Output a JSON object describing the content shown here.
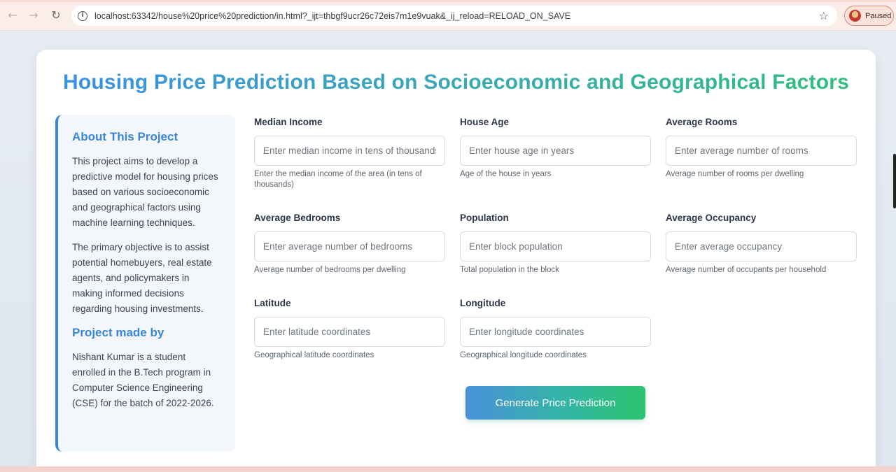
{
  "browser": {
    "url": "localhost:63342/house%20price%20prediction/in.html?_ijt=thbgf9ucr26c72eis7m1e9vuak&_ij_reload=RELOAD_ON_SAVE",
    "back_icon": "←",
    "forward_icon": "→",
    "reload_icon": "↻",
    "info_icon": "i",
    "star_icon": "☆",
    "profile_status": "Paused"
  },
  "page": {
    "title": "Housing Price Prediction Based on Socioeconomic and Geographical Factors"
  },
  "sidebar": {
    "about_heading": "About This Project",
    "about_p1": "This project aims to develop a predictive model for housing prices based on various socioeconomic and geographical factors using machine learning techniques.",
    "about_p2": "The primary objective is to assist potential homebuyers, real estate agents, and policymakers in making informed decisions regarding housing investments.",
    "made_by_heading": "Project made by",
    "made_by_text": "Nishant Kumar is a student enrolled in the B.Tech program in Computer Science Engineering (CSE) for the batch of 2022-2026."
  },
  "form": {
    "fields": [
      {
        "label": "Median Income",
        "placeholder": "Enter median income in tens of thousands",
        "hint": "Enter the median income of the area (in tens of thousands)"
      },
      {
        "label": "House Age",
        "placeholder": "Enter house age in years",
        "hint": "Age of the house in years"
      },
      {
        "label": "Average Rooms",
        "placeholder": "Enter average number of rooms",
        "hint": "Average number of rooms per dwelling"
      },
      {
        "label": "Average Bedrooms",
        "placeholder": "Enter average number of bedrooms",
        "hint": "Average number of bedrooms per dwelling"
      },
      {
        "label": "Population",
        "placeholder": "Enter block population",
        "hint": "Total population in the block"
      },
      {
        "label": "Average Occupancy",
        "placeholder": "Enter average occupancy",
        "hint": "Average number of occupants per household"
      },
      {
        "label": "Latitude",
        "placeholder": "Enter latitude coordinates",
        "hint": "Geographical latitude coordinates"
      },
      {
        "label": "Longitude",
        "placeholder": "Enter longitude coordinates",
        "hint": "Geographical longitude coordinates"
      }
    ],
    "submit_label": "Generate Price Prediction"
  },
  "colors": {
    "accent_blue": "#3a86d6",
    "accent_green": "#2cc46e"
  }
}
